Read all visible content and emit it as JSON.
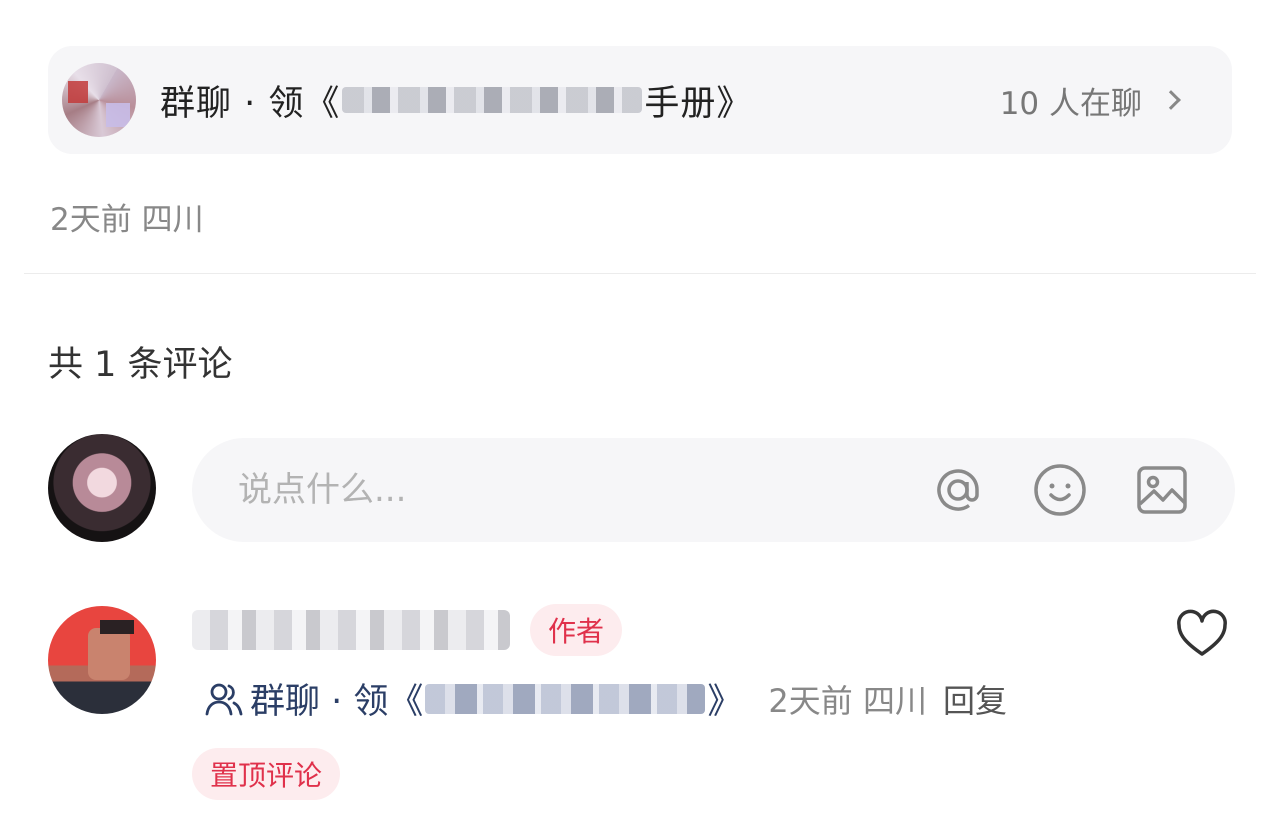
{
  "group_card": {
    "title_prefix": "群聊 · 领《",
    "title_suffix": "手册》",
    "member_count": "10 人在聊"
  },
  "post_meta": "2天前 四川",
  "comments": {
    "count_label": "共 1 条评论",
    "input_placeholder": "说点什么...",
    "items": [
      {
        "author_tag": "作者",
        "group_prefix": "群聊 · 领《",
        "group_suffix": "》",
        "time_location": "2天前 四川",
        "reply_label": "回复",
        "pin_label": "置顶评论"
      }
    ]
  },
  "icons": {
    "chevron": "chevron-right-icon",
    "mention": "at-icon",
    "emoji": "smile-icon",
    "image": "image-icon",
    "like": "heart-icon",
    "people": "people-icon"
  },
  "colors": {
    "accent_red": "#e0314b",
    "tag_bg": "#fdecee",
    "link_blue": "#2b3e66",
    "muted_text": "#888888"
  }
}
